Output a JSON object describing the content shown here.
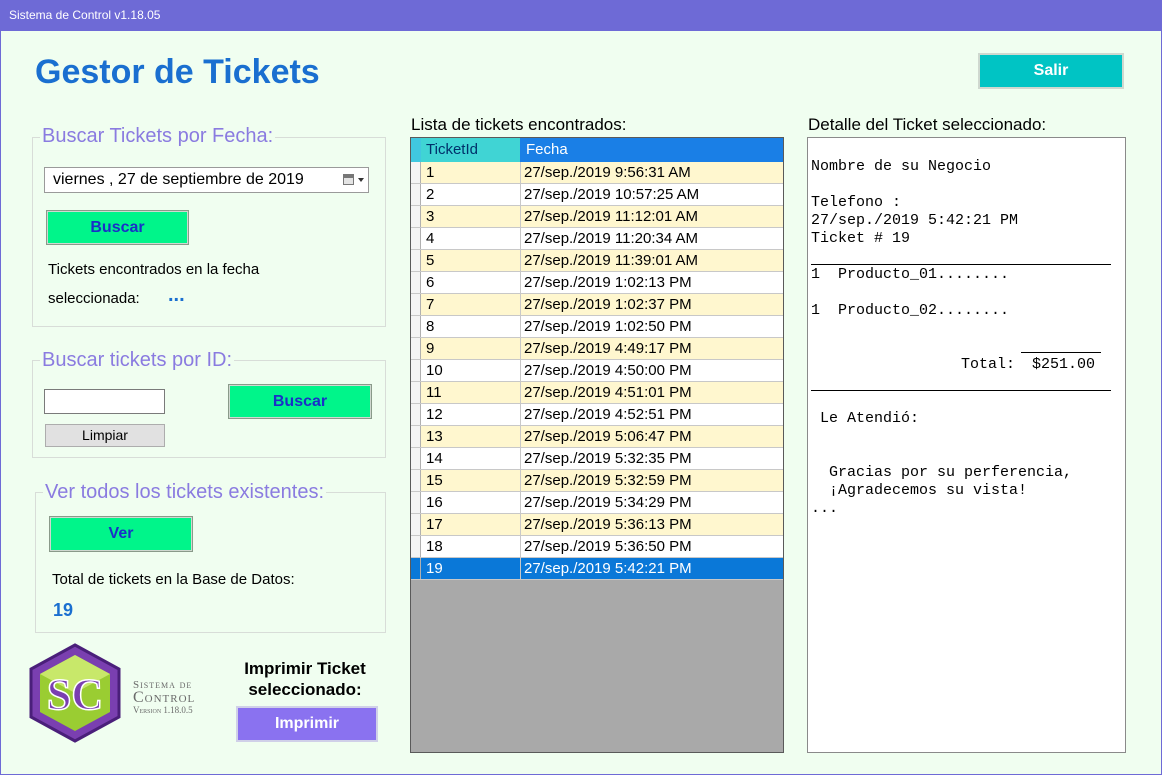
{
  "window": {
    "title": "Sistema de Control v1.18.05"
  },
  "header": {
    "title": "Gestor de Tickets",
    "exit_label": "Salir"
  },
  "search_date": {
    "group_title": "Buscar Tickets por Fecha:",
    "date_value": "viernes  , 27 de septiembre de 2019",
    "search_label": "Buscar",
    "found_text_1": "Tickets encontrados en la fecha",
    "found_text_2": "seleccionada:",
    "found_value": "..."
  },
  "search_id": {
    "group_title": "Buscar tickets por ID:",
    "input_value": "",
    "search_label": "Buscar",
    "clear_label": "Limpiar"
  },
  "view_all": {
    "group_title": "Ver todos los tickets existentes:",
    "view_label": "Ver",
    "total_text": "Total de tickets en la Base de Datos:",
    "total_value": "19"
  },
  "print": {
    "label": "Imprimir Ticket seleccionado:",
    "button_label": "Imprimir"
  },
  "logo": {
    "letters": "SC",
    "line1": "Sistema de",
    "line2": "Control",
    "line3": "Version 1.18.0.5"
  },
  "ticket_list": {
    "label": "Lista de tickets encontrados:",
    "columns": [
      "TicketId",
      "Fecha"
    ],
    "selected_index": 18,
    "rows": [
      {
        "id": "1",
        "fecha": "27/sep./2019 9:56:31 AM"
      },
      {
        "id": "2",
        "fecha": "27/sep./2019 10:57:25 AM"
      },
      {
        "id": "3",
        "fecha": "27/sep./2019 11:12:01 AM"
      },
      {
        "id": "4",
        "fecha": "27/sep./2019 11:20:34 AM"
      },
      {
        "id": "5",
        "fecha": "27/sep./2019 11:39:01 AM"
      },
      {
        "id": "6",
        "fecha": "27/sep./2019 1:02:13 PM"
      },
      {
        "id": "7",
        "fecha": "27/sep./2019 1:02:37 PM"
      },
      {
        "id": "8",
        "fecha": "27/sep./2019 1:02:50 PM"
      },
      {
        "id": "9",
        "fecha": "27/sep./2019 4:49:17 PM"
      },
      {
        "id": "10",
        "fecha": "27/sep./2019 4:50:00 PM"
      },
      {
        "id": "11",
        "fecha": "27/sep./2019 4:51:01 PM"
      },
      {
        "id": "12",
        "fecha": "27/sep./2019 4:52:51 PM"
      },
      {
        "id": "13",
        "fecha": "27/sep./2019 5:06:47 PM"
      },
      {
        "id": "14",
        "fecha": "27/sep./2019 5:32:35 PM"
      },
      {
        "id": "15",
        "fecha": "27/sep./2019 5:32:59 PM"
      },
      {
        "id": "16",
        "fecha": "27/sep./2019 5:34:29 PM"
      },
      {
        "id": "17",
        "fecha": "27/sep./2019 5:36:13 PM"
      },
      {
        "id": "18",
        "fecha": "27/sep./2019 5:36:50 PM"
      },
      {
        "id": "19",
        "fecha": "27/sep./2019 5:42:21 PM"
      }
    ]
  },
  "detail": {
    "label": "Detalle del Ticket seleccionado:",
    "business": "Nombre de su Negocio",
    "phone": "Telefono :",
    "datetime": "27/sep./2019 5:42:21 PM",
    "ticket_no": "Ticket # 19",
    "item1": "1  Producto_01........",
    "item2": "1  Producto_02........",
    "total_label": "Total:",
    "total_value": "$251.00",
    "attended": " Le Atendió:",
    "thanks1": "  Gracias por su perferencia,",
    "thanks2": "  ¡Agradecemos su vista!",
    "ellipsis": "..."
  },
  "colors": {
    "titlebar": "#6e6ad6",
    "background": "#f0fef0",
    "accent_blue": "#1a6fd0",
    "group_title": "#8a7be0",
    "button_green": "#00f58a",
    "button_cyan": "#00c4c4",
    "button_purple": "#8a72f0",
    "row_alt": "#fff7cf",
    "row_selected": "#0a78d8"
  }
}
